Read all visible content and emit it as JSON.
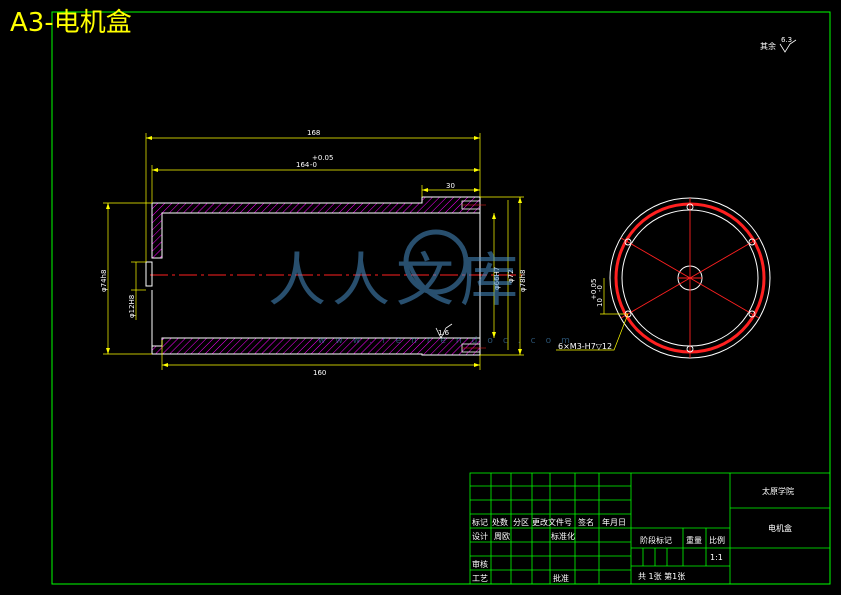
{
  "title": "A3-电机盒",
  "roughness_note": {
    "label": "其余",
    "value": "6.3"
  },
  "section_view": {
    "dim_total_length": "168",
    "dim_inner_length": "164",
    "dim_inner_tol_upper": "+0.05",
    "dim_inner_tol_lower": "-0",
    "dim_shoulder": "30",
    "dim_bottom_length": "160",
    "dim_left_diameter": "φ74h8",
    "dim_small_bore": "φ12H8",
    "dim_inner_diameter": "φ66H7",
    "dim_mid_diameter": "φ72",
    "dim_outer_diameter": "φ78h8",
    "roughness_inner": "1.6"
  },
  "end_view": {
    "dim_offset_tol": "+0.05",
    "dim_offset_base": "10",
    "dim_offset_low": "-0",
    "hole_callout": "6×M3-H7▽12"
  },
  "watermark": {
    "text": "人人文库",
    "url": "www.renrendoc.com"
  },
  "title_block": {
    "school": "太原学院",
    "part_name": "电机盒",
    "row_headers": [
      "标记",
      "处数",
      "分区",
      "更改文件号",
      "签名",
      "年月日"
    ],
    "design": "设计",
    "design_name": "周欧",
    "standardize": "标准化",
    "review": "审核",
    "process": "工艺",
    "approve": "批准",
    "stage_mark": "阶段标记",
    "weight": "重量",
    "scale": "比例",
    "scale_value": "1:1",
    "sheets": "共 1张 第1张"
  }
}
